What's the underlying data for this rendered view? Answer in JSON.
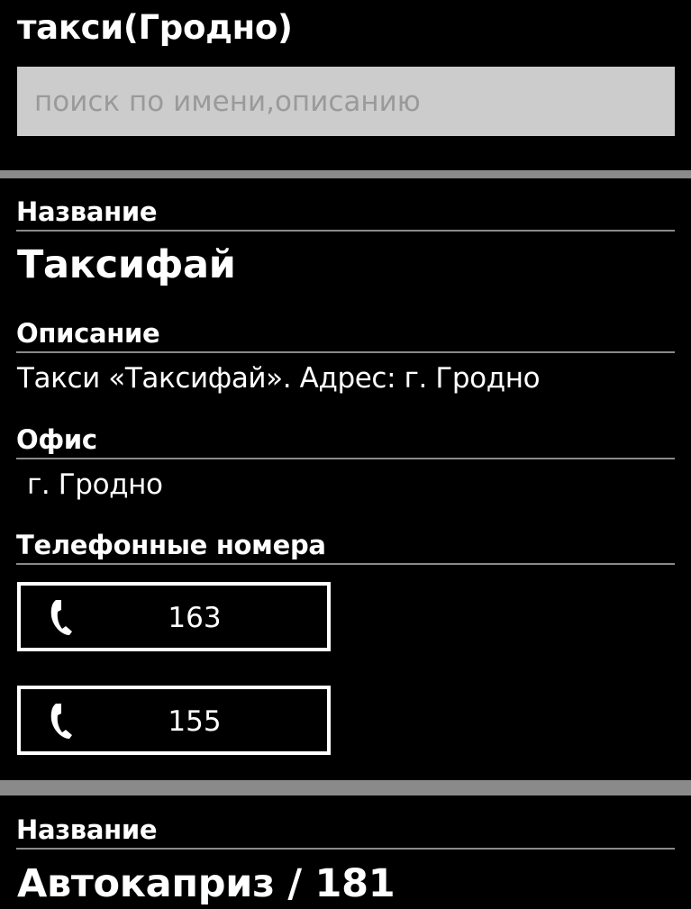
{
  "header": {
    "title": "такси(Гродно)"
  },
  "search": {
    "placeholder": "поиск по имени,описанию",
    "value": ""
  },
  "entries": [
    {
      "name_label": "Название",
      "name": "Таксифай",
      "description_label": "Описание",
      "description": "Такси «Таксифай». Адрес: г. Гродно",
      "office_label": "Офис",
      "office": "г. Гродно",
      "phones_label": "Телефонные номера",
      "phones": [
        "163",
        "155"
      ]
    },
    {
      "name_label": "Название",
      "name": "Автокаприз / 181"
    }
  ],
  "colors": {
    "background": "#000000",
    "text": "#ffffff",
    "search_box": "#cccccc",
    "placeholder": "#9a9a9a",
    "separator": "#8a8a8a"
  },
  "icons": {
    "phone": "phone-icon"
  }
}
